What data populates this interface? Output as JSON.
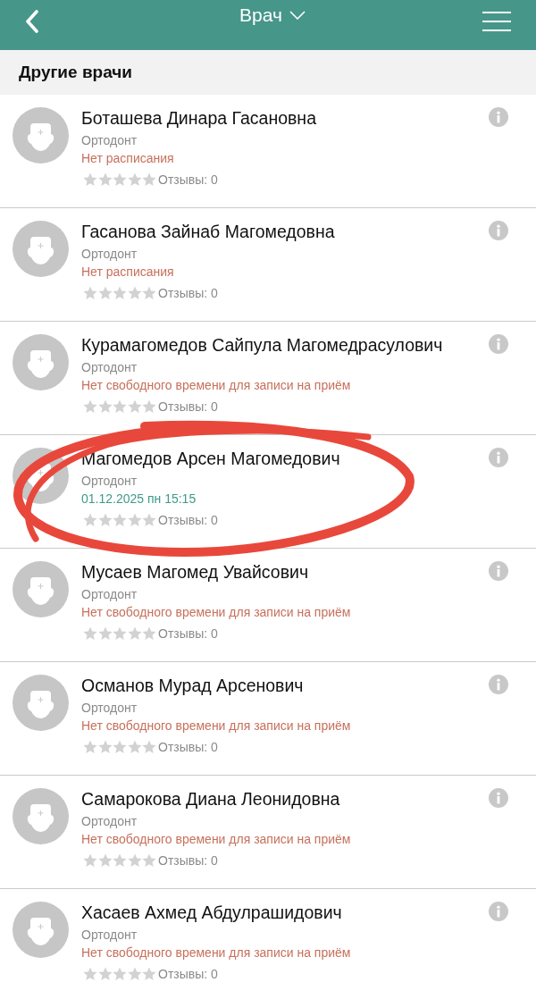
{
  "header": {
    "title": "Врач"
  },
  "section": {
    "title": "Другие врачи"
  },
  "doctors": [
    {
      "name": "Боташева Динара Гасановна",
      "specialty": "Ортодонт",
      "status": {
        "kind": "unavailable",
        "text": "Нет расписания"
      },
      "stars": 0,
      "reviews": "Отзывы: 0",
      "circled": false
    },
    {
      "name": "Гасанова Зайнаб Магомедовна",
      "specialty": "Ортодонт",
      "status": {
        "kind": "unavailable",
        "text": "Нет расписания"
      },
      "stars": 0,
      "reviews": "Отзывы: 0",
      "circled": false
    },
    {
      "name": "Курамагомедов Сайпула Магомедрасулович",
      "specialty": "Ортодонт",
      "status": {
        "kind": "unavailable",
        "text": "Нет свободного времени для записи на приём"
      },
      "stars": 0,
      "reviews": "Отзывы: 0",
      "circled": false
    },
    {
      "name": "Магомедов Арсен Магомедович",
      "specialty": "Ортодонт",
      "status": {
        "kind": "slot",
        "text": "01.12.2025 пн 15:15"
      },
      "stars": 0,
      "reviews": "Отзывы: 0",
      "circled": true
    },
    {
      "name": "Мусаев Магомед Увайсович",
      "specialty": "Ортодонт",
      "status": {
        "kind": "unavailable",
        "text": "Нет свободного времени для записи на приём"
      },
      "stars": 0,
      "reviews": "Отзывы: 0",
      "circled": false
    },
    {
      "name": "Османов Мурад Арсенович",
      "specialty": "Ортодонт",
      "status": {
        "kind": "unavailable",
        "text": "Нет свободного времени для записи на приём"
      },
      "stars": 0,
      "reviews": "Отзывы: 0",
      "circled": false
    },
    {
      "name": "Самарокова Диана Леонидовна",
      "specialty": "Ортодонт",
      "status": {
        "kind": "unavailable",
        "text": "Нет свободного времени для записи на приём"
      },
      "stars": 0,
      "reviews": "Отзывы: 0",
      "circled": false
    },
    {
      "name": "Хасаев Ахмед Абдулрашидович",
      "specialty": "Ортодонт",
      "status": {
        "kind": "unavailable",
        "text": "Нет свободного времени для записи на приём"
      },
      "stars": 0,
      "reviews": "Отзывы: 0",
      "circled": false
    }
  ]
}
